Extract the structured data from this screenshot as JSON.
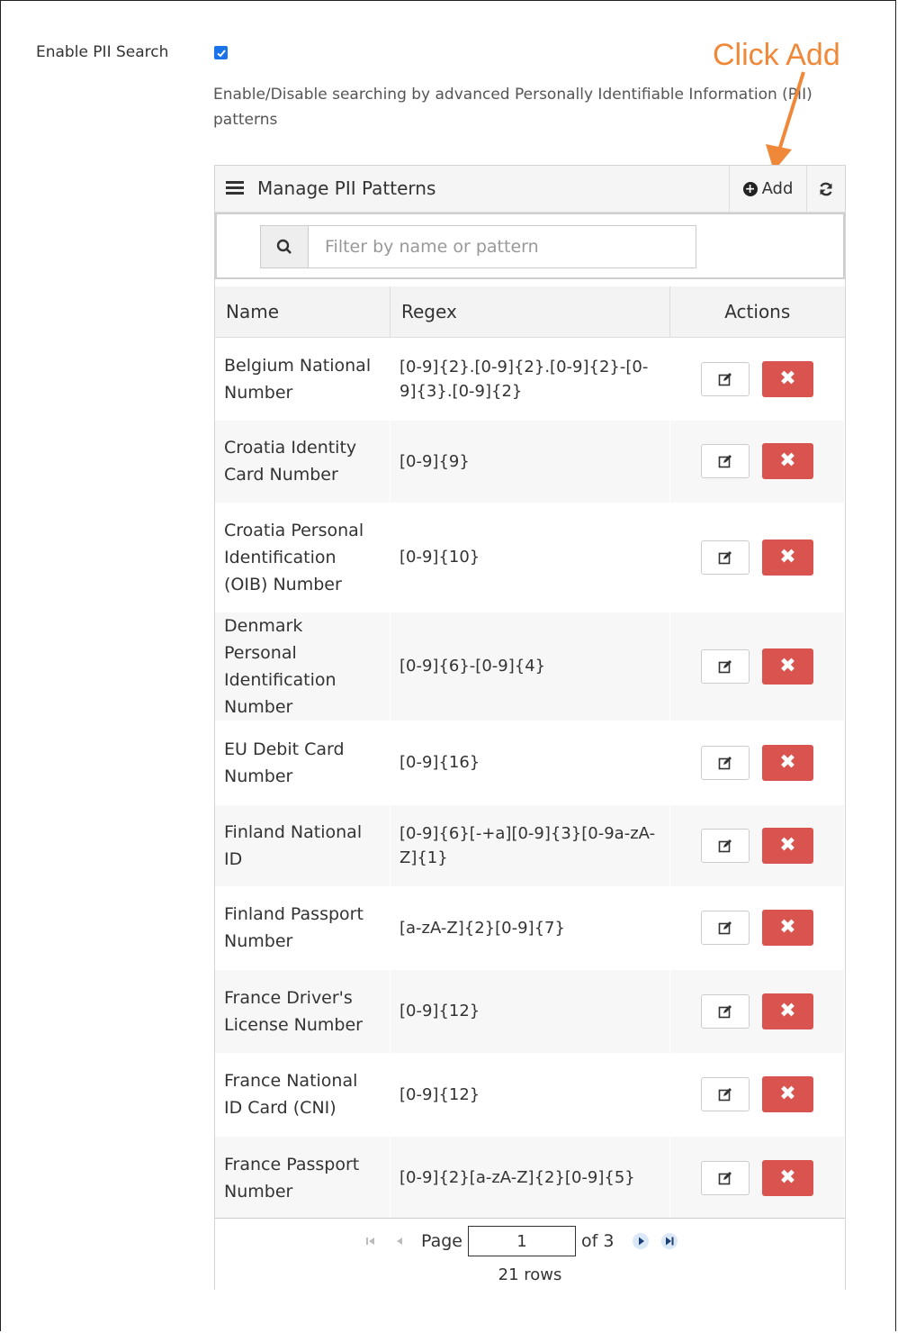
{
  "setting": {
    "label": "Enable PII Search",
    "checked": true,
    "help": "Enable/Disable searching by advanced Personally Identifiable Information (PII) patterns"
  },
  "annotation": {
    "text": "Click Add",
    "color": "#f0883a"
  },
  "panel": {
    "title": "Manage PII Patterns",
    "add_label": "Add",
    "filter_placeholder": "Filter by name or pattern"
  },
  "table": {
    "headers": [
      "Name",
      "Regex",
      "Actions"
    ],
    "rows": [
      {
        "name": "Belgium National Number",
        "regex": "[0-9]{2}.[0-9]{2}.[0-9]{2}-[0-9]{3}.[0-9]{2}"
      },
      {
        "name": "Croatia Identity Card Number",
        "regex": "[0-9]{9}"
      },
      {
        "name": "Croatia Personal Identification (OIB) Number",
        "regex": "[0-9]{10}"
      },
      {
        "name": "Denmark Personal Identification Number",
        "regex": "[0-9]{6}-[0-9]{4}"
      },
      {
        "name": "EU Debit Card Number",
        "regex": "[0-9]{16}"
      },
      {
        "name": "Finland National ID",
        "regex": "[0-9]{6}[-+a][0-9]{3}[0-9a-zA-Z]{1}"
      },
      {
        "name": "Finland Passport Number",
        "regex": "[a-zA-Z]{2}[0-9]{7}"
      },
      {
        "name": "France Driver's License Number",
        "regex": "[0-9]{12}"
      },
      {
        "name": "France National ID Card (CNI)",
        "regex": "[0-9]{12}"
      },
      {
        "name": "France Passport Number",
        "regex": "[0-9]{2}[a-zA-Z]{2}[0-9]{5}"
      }
    ]
  },
  "pager": {
    "page_label": "Page",
    "page_value": "1",
    "of_label": "of 3",
    "rows_label": "21 rows"
  },
  "colors": {
    "delete": "#d9534f",
    "checkbox": "#1a73e8",
    "accent_annotation": "#f0883a"
  }
}
